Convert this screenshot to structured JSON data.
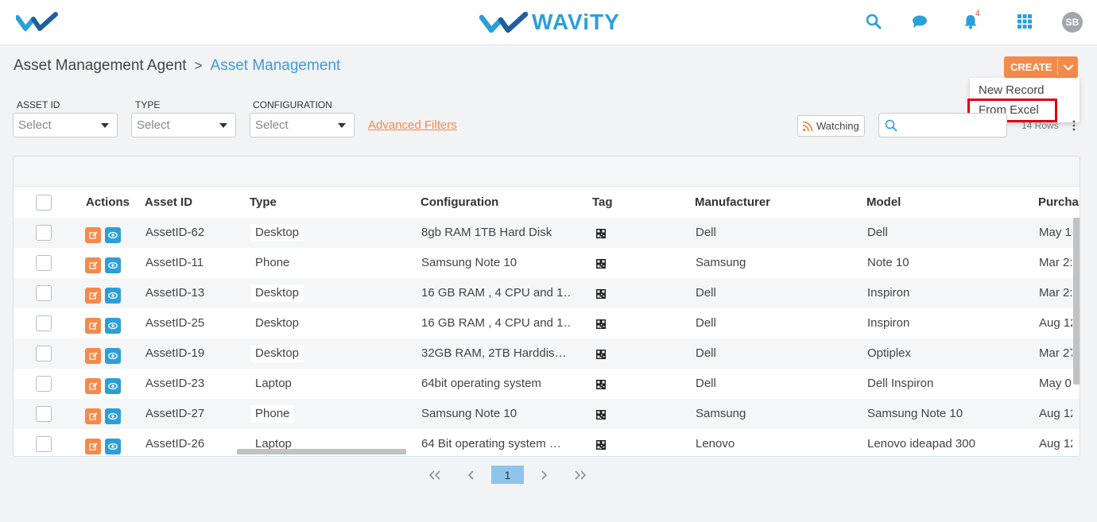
{
  "header": {
    "brand_name": "WAViTY",
    "notification_count": "4",
    "avatar_initials": "SB"
  },
  "breadcrumb": {
    "parent": "Asset Management Agent",
    "separator": ">",
    "current": "Asset Management"
  },
  "create": {
    "label": "CREATE",
    "menu": {
      "new_record": "New Record",
      "from_excel": "From Excel"
    }
  },
  "filters": {
    "asset_id": {
      "label": "ASSET ID",
      "value": "Select"
    },
    "type": {
      "label": "TYPE",
      "value": "Select"
    },
    "configuration": {
      "label": "CONFIGURATION",
      "value": "Select"
    },
    "advanced": "Advanced Filters"
  },
  "toolbar": {
    "watching_label": "Watching",
    "search_placeholder": "",
    "rows_count": "14 Rows"
  },
  "table": {
    "columns": {
      "actions": "Actions",
      "asset_id": "Asset ID",
      "type": "Type",
      "configuration": "Configuration",
      "tag": "Tag",
      "manufacturer": "Manufacturer",
      "model": "Model",
      "purchase": "Purchas"
    },
    "rows": [
      {
        "asset_id": "AssetID-62",
        "type": "Desktop",
        "configuration": "8gb RAM 1TB Hard Disk",
        "manufacturer": "Dell",
        "model": "Dell",
        "purchase": "May 1("
      },
      {
        "asset_id": "AssetID-11",
        "type": "Phone",
        "configuration": "Samsung Note 10",
        "manufacturer": "Samsung",
        "model": "Note 10",
        "purchase": "Mar 2:"
      },
      {
        "asset_id": "AssetID-13",
        "type": "Desktop",
        "configuration": "16 GB RAM , 4 CPU and 1…",
        "manufacturer": "Dell",
        "model": "Inspiron",
        "purchase": "Mar 2:"
      },
      {
        "asset_id": "AssetID-25",
        "type": "Desktop",
        "configuration": "16 GB RAM , 4 CPU and 1…",
        "manufacturer": "Dell",
        "model": "Inspiron",
        "purchase": "Aug 12"
      },
      {
        "asset_id": "AssetID-19",
        "type": "Desktop",
        "configuration": "32GB RAM, 2TB Harddis…",
        "manufacturer": "Dell",
        "model": "Optiplex",
        "purchase": "Mar 27"
      },
      {
        "asset_id": "AssetID-23",
        "type": "Laptop",
        "configuration": "64bit operating system",
        "manufacturer": "Dell",
        "model": "Dell Inspiron",
        "purchase": "May 0"
      },
      {
        "asset_id": "AssetID-27",
        "type": "Phone",
        "configuration": "Samsung Note 10",
        "manufacturer": "Samsung",
        "model": "Samsung Note 10",
        "purchase": "Aug 12"
      },
      {
        "asset_id": "AssetID-26",
        "type": "Laptop",
        "configuration": "64 Bit operating system …",
        "manufacturer": "Lenovo",
        "model": "Lenovo ideapad 300",
        "purchase": "Aug 12"
      }
    ]
  },
  "pagination": {
    "current_page": "1"
  },
  "colors": {
    "accent_orange": "#f48a4a",
    "accent_blue": "#2d9fd8",
    "highlight_red": "#e0000c"
  }
}
